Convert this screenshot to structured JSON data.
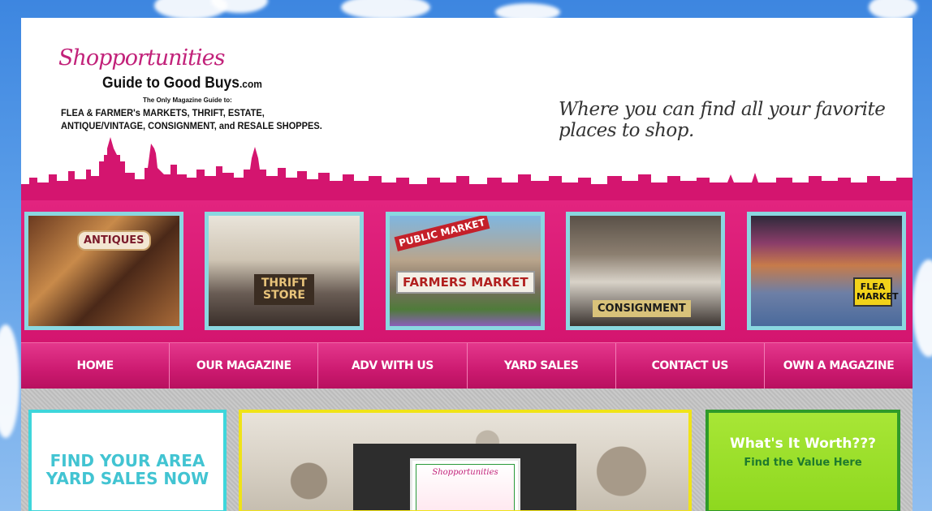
{
  "header": {
    "brand_script": "Shopportunities",
    "brand_main": "Guide to Good Buys",
    "brand_domain": ".com",
    "brand_sub": "The Only Magazine Guide to:",
    "brand_lines": [
      "FLEA & FARMER's MARKETS, THRIFT, ESTATE,",
      "ANTIQUE/VINTAGE, CONSIGNMENT, and RESALE SHOPPES."
    ],
    "tagline": "Where you can find all your favorite places to shop."
  },
  "photos": [
    {
      "label": "ANTIQUES"
    },
    {
      "label": "THRIFT STORE"
    },
    {
      "label_top": "PUBLIC MARKET",
      "label": "FARMERS MARKET"
    },
    {
      "label": "CONSIGNMENT"
    },
    {
      "label": "FLEA MARKET"
    }
  ],
  "nav": [
    {
      "label": "HOME"
    },
    {
      "label": "OUR MAGAZINE"
    },
    {
      "label": "ADV WITH US"
    },
    {
      "label": "YARD SALES"
    },
    {
      "label": "CONTACT US"
    },
    {
      "label": "OWN A MAGAZINE"
    }
  ],
  "cards": {
    "yard_sales_line1": "FIND YOUR AREA",
    "yard_sales_line2": "YARD SALES NOW",
    "magazine_cover": "Shopportunities",
    "worth_title": "What's It Worth???",
    "worth_sub": "Find the Value Here"
  },
  "colors": {
    "brand_pink": "#d4156f",
    "photo_border": "#8ad7e0",
    "yard_card_border": "#3ed6db",
    "mid_card_border": "#f0e318",
    "worth_card_bg": "#9adf2a"
  }
}
